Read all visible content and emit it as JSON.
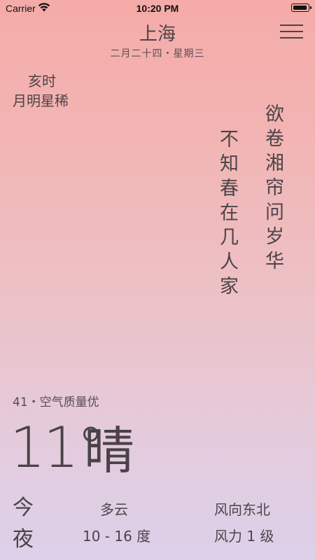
{
  "status_bar": {
    "carrier": "Carrier",
    "time": "10:20 PM",
    "wifi_icon": "wifi-icon",
    "battery_icon": "battery-icon"
  },
  "header": {
    "city": "上海",
    "date": "二月二十四・星期三",
    "menu_icon": "hamburger-menu-icon"
  },
  "time_info": {
    "period": "亥时",
    "phrase": "月明星稀"
  },
  "poem": {
    "line1": "欲卷湘帘问岁华",
    "line2": "不知春在几人家"
  },
  "weather": {
    "aqi_text": "41・空气质量优",
    "temperature": "11°",
    "condition": "晴"
  },
  "forecast": {
    "day_label": "今",
    "night_label": "夜",
    "condition": "多云",
    "temp_range": "10 - 16 度",
    "wind_direction": "风向东北",
    "wind_force": "风力 1 级"
  }
}
